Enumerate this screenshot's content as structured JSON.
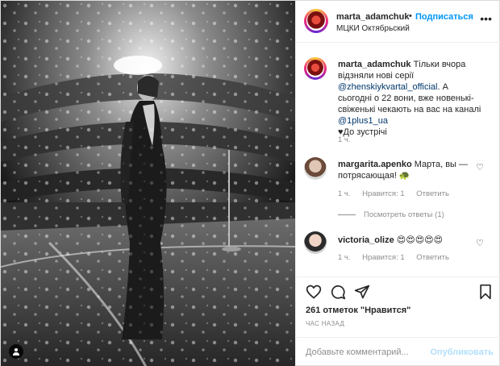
{
  "header": {
    "username": "marta_adamchuk",
    "separator": "•",
    "follow_label": "Подписаться",
    "location": "МЦКИ Октябрьский",
    "more_icon": "more-horizontal-icon"
  },
  "caption": {
    "username": "marta_adamchuk",
    "text_1": "Тільки вчора відзняли нові серії",
    "mention_1": "@zhenskiykvartal_official",
    "text_2": ". А сьогодні о 22 вони, вже новенькі-свіженькі чекають на вас на каналі",
    "mention_2": "@1plus1_ua",
    "text_3": "♥До зустрічі",
    "time": "1 ч."
  },
  "comments": [
    {
      "username": "margarita.apenko",
      "text": "Марта, вы — потрясающая! 🐢",
      "time": "1 ч.",
      "likes": "Нравится: 1",
      "reply": "Ответить",
      "view_replies": "Посмотреть ответы (1)"
    },
    {
      "username": "victoria_olize",
      "text": "😍😍😍😍😍",
      "time": "1 ч.",
      "likes": "Нравится: 1",
      "reply": "Ответить"
    }
  ],
  "actions": {
    "like_icon": "heart-icon",
    "comment_icon": "comment-icon",
    "share_icon": "share-icon",
    "save_icon": "bookmark-icon"
  },
  "likes_text": "261 отметок \"Нравится\"",
  "time_ago": "ЧАС НАЗАД",
  "add_comment": {
    "placeholder": "Добавьте комментарий...",
    "publish_label": "Опубликовать"
  },
  "colors": {
    "link": "#00376b",
    "follow": "#0095f6",
    "publish_disabled": "#b2dffc",
    "muted": "#8e8e8e"
  }
}
